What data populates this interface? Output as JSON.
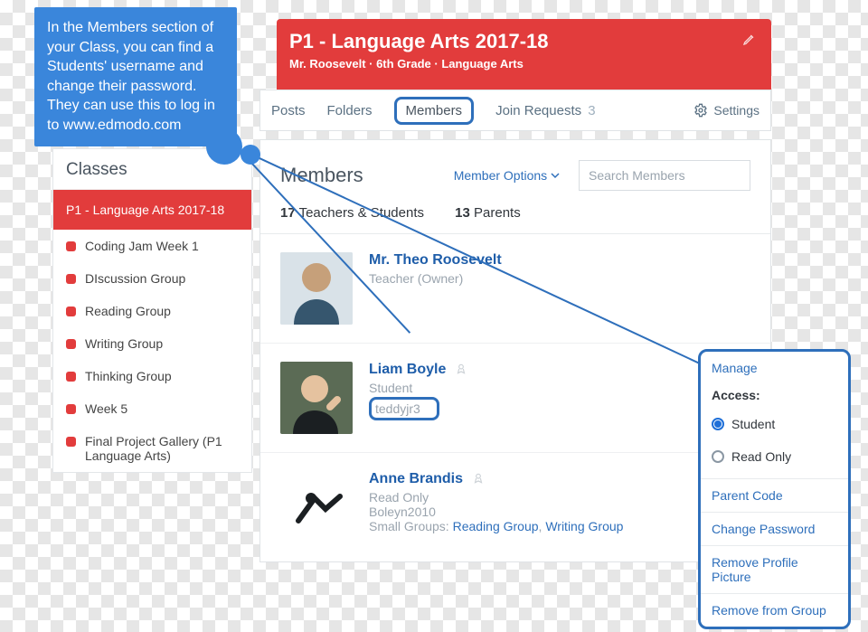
{
  "callout_text": "In the Members section of your Class, you can find a Students' username and change their password. They can use this to log in to www.edmodo.com",
  "header": {
    "title": "P1 - Language Arts 2017-18",
    "subtitle": "Mr. Roosevelt · 6th Grade · Language Arts"
  },
  "tabs": {
    "posts": "Posts",
    "folders": "Folders",
    "members": "Members",
    "join_requests": "Join Requests",
    "join_requests_count": "3",
    "settings": "Settings"
  },
  "sidebar": {
    "title": "Classes",
    "items": [
      {
        "label": "P1 - Language Arts 2017-18",
        "active": true
      },
      {
        "label": "Coding Jam Week 1"
      },
      {
        "label": "DIscussion Group"
      },
      {
        "label": "Reading Group"
      },
      {
        "label": "Writing Group"
      },
      {
        "label": "Thinking Group"
      },
      {
        "label": "Week 5"
      },
      {
        "label": "Final Project Gallery (P1 Language Arts)"
      }
    ]
  },
  "panel": {
    "title": "Members",
    "member_options": "Member Options",
    "search_placeholder": "Search Members",
    "count_ts_num": "17",
    "count_ts_label": " Teachers & Students",
    "count_p_num": "13",
    "count_p_label": " Parents"
  },
  "members": [
    {
      "name": "Mr. Theo Roosevelt",
      "role": "Teacher (Owner)"
    },
    {
      "name": "Liam Boyle",
      "role": "Student",
      "username": "teddyjr3",
      "progress": "Progress"
    },
    {
      "name": "Anne Brandis",
      "role": "Read Only",
      "username": "Boleyn2010",
      "progress": "Progress",
      "sg_prefix": "Small Groups: ",
      "sg1": "Reading Group",
      "sg_sep": ", ",
      "sg2": "Writing Group"
    }
  ],
  "manage": {
    "title": "Manage",
    "access_label": "Access:",
    "opt_student": "Student",
    "opt_readonly": "Read Only",
    "links": [
      "Parent Code",
      "Change Password",
      "Remove Profile Picture",
      "Remove from Group"
    ]
  }
}
